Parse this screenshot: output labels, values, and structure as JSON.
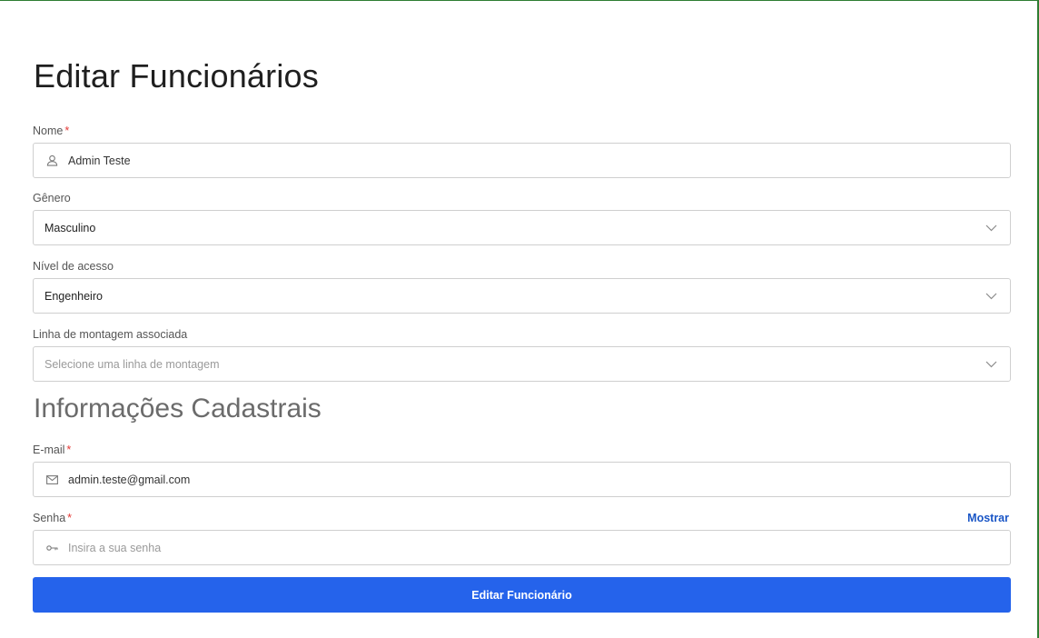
{
  "page": {
    "title": "Editar Funcionários",
    "section_title": "Informações Cadastrais"
  },
  "fields": {
    "name": {
      "label": "Nome",
      "required_mark": "*",
      "value": "Admin Teste",
      "icon": "user-icon"
    },
    "gender": {
      "label": "Gênero",
      "value": "Masculino"
    },
    "access_level": {
      "label": "Nível de acesso",
      "value": "Engenheiro"
    },
    "assembly_line": {
      "label": "Linha de montagem associada",
      "placeholder": "Selecione uma linha de montagem"
    },
    "email": {
      "label": "E-mail",
      "required_mark": "*",
      "value": "admin.teste@gmail.com",
      "icon": "mail-icon"
    },
    "password": {
      "label": "Senha",
      "required_mark": "*",
      "placeholder": "Insira a sua senha",
      "show_label": "Mostrar",
      "icon": "key-icon"
    }
  },
  "submit": {
    "label": "Editar Funcionário"
  },
  "colors": {
    "primary": "#2563eb",
    "link": "#1a56c6",
    "required": "#e53935",
    "frame": "#2e7d32"
  }
}
